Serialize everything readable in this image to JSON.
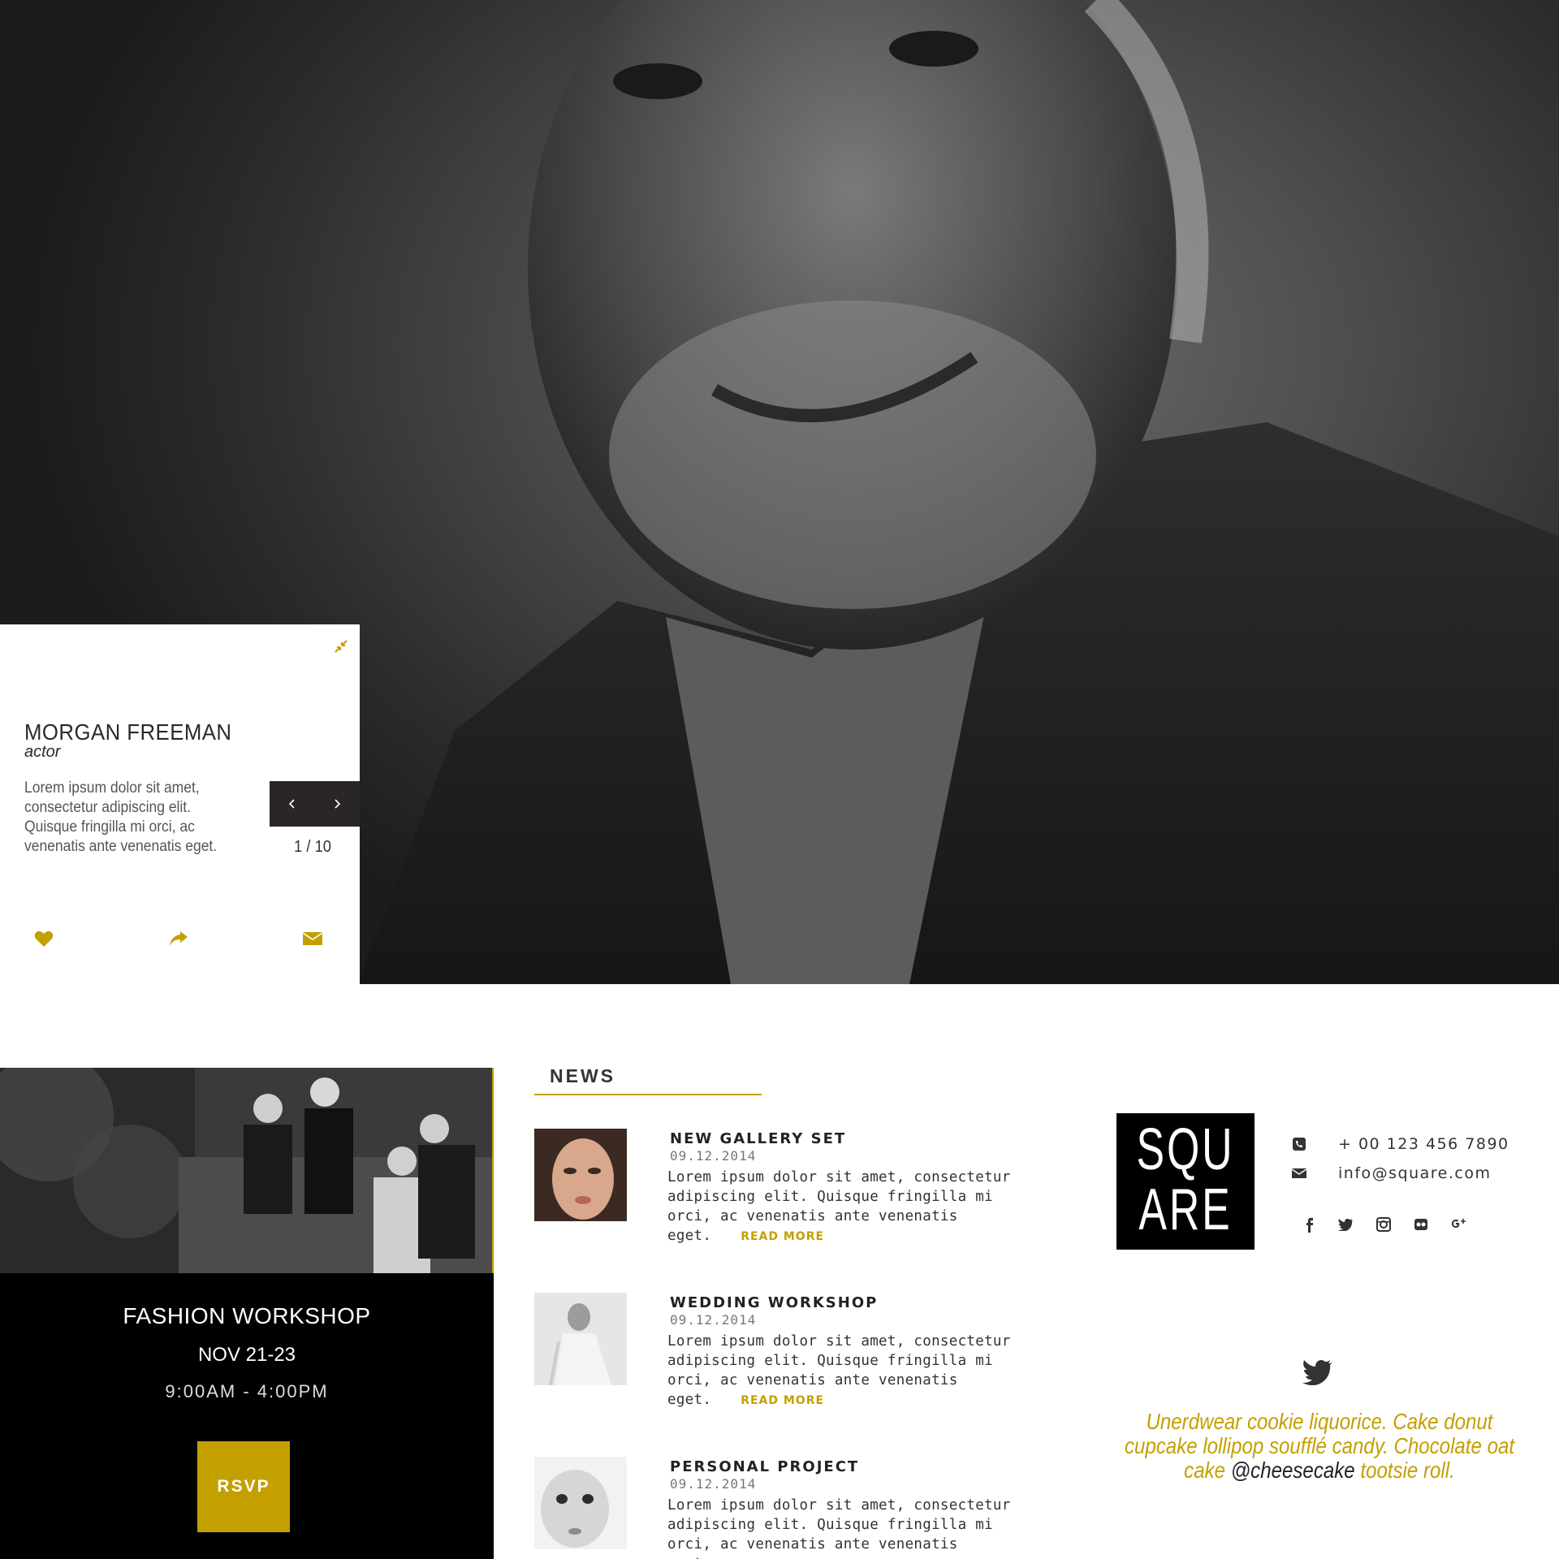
{
  "colors": {
    "accent": "#c49f00",
    "dark": "#2b2626",
    "black": "#000000"
  },
  "hero": {
    "person": {
      "name": "MORGAN FREEMAN",
      "role": "actor",
      "description": "Lorem ipsum dolor sit amet, consectetur adipiscing elit. Quisque fringilla mi orci, ac venenatis ante venenatis eget."
    },
    "slider": {
      "counter": "1 / 10",
      "prev_icon": "chevron-left-icon",
      "next_icon": "chevron-right-icon"
    },
    "actions": [
      "heart-icon",
      "share-icon",
      "envelope-icon"
    ]
  },
  "event": {
    "title": "FASHION WORKSHOP",
    "date": "NOV 21-23",
    "time": "9:00AM - 4:00PM",
    "rsvp_label": "RSVP"
  },
  "news": {
    "heading": "NEWS",
    "read_more_label": "READ MORE",
    "items": [
      {
        "title": "NEW GALLERY SET",
        "date": "09.12.2014",
        "text": "Lorem ipsum dolor sit amet, consectetur adipiscing elit. Quisque fringilla mi orci, ac venenatis ante venenatis eget."
      },
      {
        "title": "WEDDING WORKSHOP",
        "date": "09.12.2014",
        "text": "Lorem ipsum dolor sit amet, consectetur adipiscing elit. Quisque fringilla mi orci, ac venenatis ante venenatis eget."
      },
      {
        "title": "PERSONAL PROJECT",
        "date": "09.12.2014",
        "text": "Lorem ipsum dolor sit amet, consectetur adipiscing elit. Quisque fringilla mi orci, ac venenatis ante venenatis eget."
      }
    ]
  },
  "sidebar": {
    "logo_line1": "SQU",
    "logo_line2": "ARE",
    "phone": "+ 00 123 456 7890",
    "email": "info@square.com",
    "socials": [
      "facebook-icon",
      "twitter-icon",
      "instagram-icon",
      "flickr-icon",
      "google-plus-icon"
    ],
    "tweet": {
      "text_before": "Unerdwear cookie liquorice. Cake donut cupcake lollipop soufflé candy. Chocolate oat cake",
      "handle": "@cheesecake",
      "text_after": "tootsie roll."
    }
  }
}
